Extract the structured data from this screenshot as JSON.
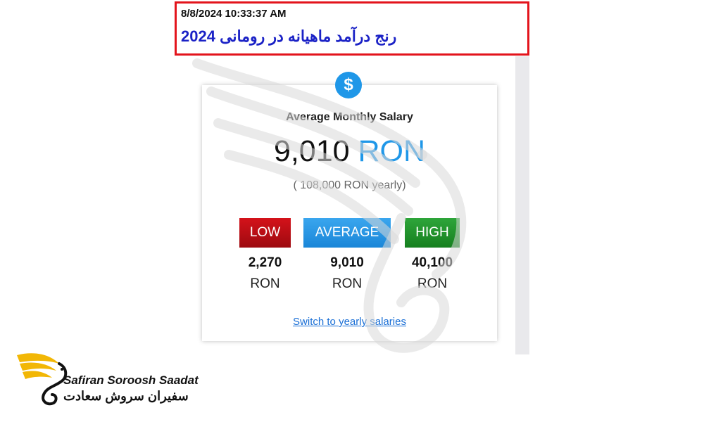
{
  "header": {
    "timestamp": "8/8/2024 10:33:37 AM",
    "title": "رنج درآمد ماهیانه در رومانی 2024",
    "border_color": "#e3141c",
    "title_color": "#1b22c6"
  },
  "card": {
    "icon": "dollar-icon",
    "title": "Average Monthly Salary",
    "salary_amount": "9,010",
    "salary_currency": "RON",
    "yearly_text": "( 108,000 RON yearly)",
    "accent_color": "#1f97e8",
    "levels": [
      {
        "label": "LOW",
        "value": "2,270",
        "unit": "RON",
        "color": "#c0111a"
      },
      {
        "label": "AVERAGE",
        "value": "9,010",
        "unit": "RON",
        "color": "#2a98e6"
      },
      {
        "label": "HIGH",
        "value": "40,100",
        "unit": "RON",
        "color": "#23952f"
      }
    ],
    "switch_link": "Switch to yearly salaries"
  },
  "logo": {
    "name_en": "Safiran Soroosh Saadat",
    "name_fa": "سفیران سروش سعادت",
    "icon": "phoenix-logo-icon"
  }
}
